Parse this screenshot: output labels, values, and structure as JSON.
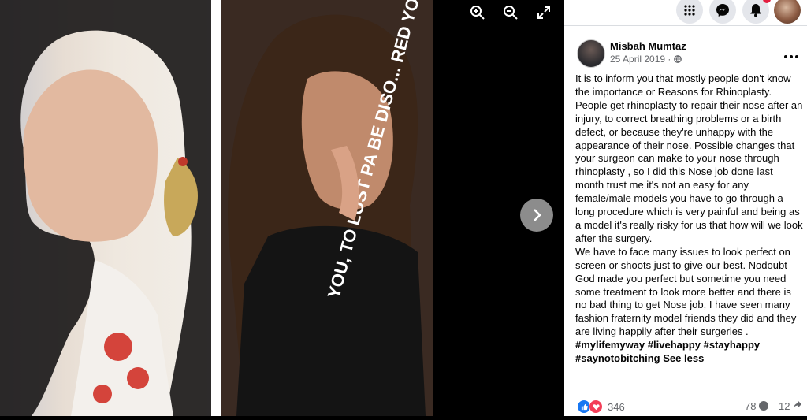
{
  "topbar": {
    "icons": [
      "menu-grid-icon",
      "messenger-icon",
      "notifications-icon"
    ],
    "notification_badge": ""
  },
  "viewer": {
    "tools": [
      "zoom-in-icon",
      "zoom-out-icon",
      "fullscreen-icon"
    ],
    "next_icon": "chevron-right-icon",
    "photo_text": "YOU, TO LOST PA BE DISO... RED YOU ...THING"
  },
  "post": {
    "author": "Misbah Mumtaz",
    "date": "25 April 2019 · ",
    "privacy_icon": "globe-icon",
    "paragraph1": "It is to inform you that mostly people don't know the importance or Reasons for Rhinoplasty. People get rhinoplasty to repair their nose after an injury, to correct breathing problems or a birth defect, or because they're unhappy with the appearance of their nose. Possible changes that your surgeon can make to your nose through rhinoplasty , so I did this Nose job done last month trust me it's not an easy for any female/male models you have to go through a long procedure which is very painful and being as a model it's really risky for us that how will we look after the surgery.",
    "paragraph2": "We have to face many issues to look perfect on screen or shoots just to give our best. Nodoubt God made you perfect but sometime you need some treatment to look more better and there is no bad thing to get Nose job, I have seen many fashion fraternity model friends they did and they are living happily after their surgeries .",
    "hashtags": "#mylifemyway #livehappy #stayhappy #saynotobitching",
    "see_less": "See less"
  },
  "stats": {
    "reactions": "346",
    "comments": "78",
    "shares": "12"
  },
  "colors": {
    "accent": "#1877f2",
    "love": "#f33e58",
    "secondary_text": "#65676b"
  }
}
